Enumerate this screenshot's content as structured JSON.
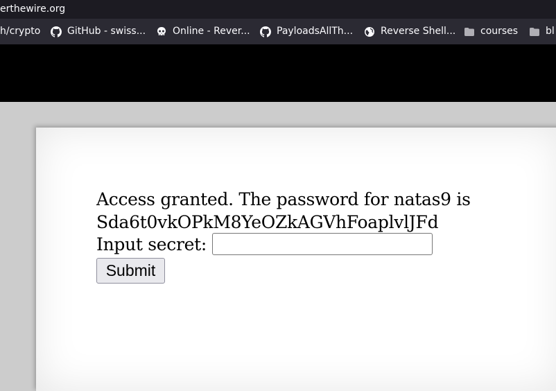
{
  "browser": {
    "url_fragment": "erthewire.org"
  },
  "bookmarks": [
    {
      "label": "h/crypto",
      "icon": "none"
    },
    {
      "label": "GitHub - swiss...",
      "icon": "github-icon"
    },
    {
      "label": "Online - Rever...",
      "icon": "skull-icon"
    },
    {
      "label": "PayloadsAllTh...",
      "icon": "github-icon"
    },
    {
      "label": "Reverse Shell...",
      "icon": "globe-icon"
    },
    {
      "label": "courses",
      "icon": "folder-icon"
    },
    {
      "label": "bl",
      "icon": "folder-icon"
    }
  ],
  "page": {
    "message_line1": "Access granted. The password for natas9 is",
    "message_line2": "Sda6t0vkOPkM8YeOZkAGVhFoaplvlJFd",
    "input_label": "Input secret:",
    "input_value": "",
    "submit_label": "Submit"
  },
  "colors": {
    "urlbar_bg": "#1c1b22",
    "bookmarks_bg": "#2b2a33",
    "header_band": "#000000",
    "page_bg": "#cccccc",
    "card_bg": "#ffffff"
  }
}
